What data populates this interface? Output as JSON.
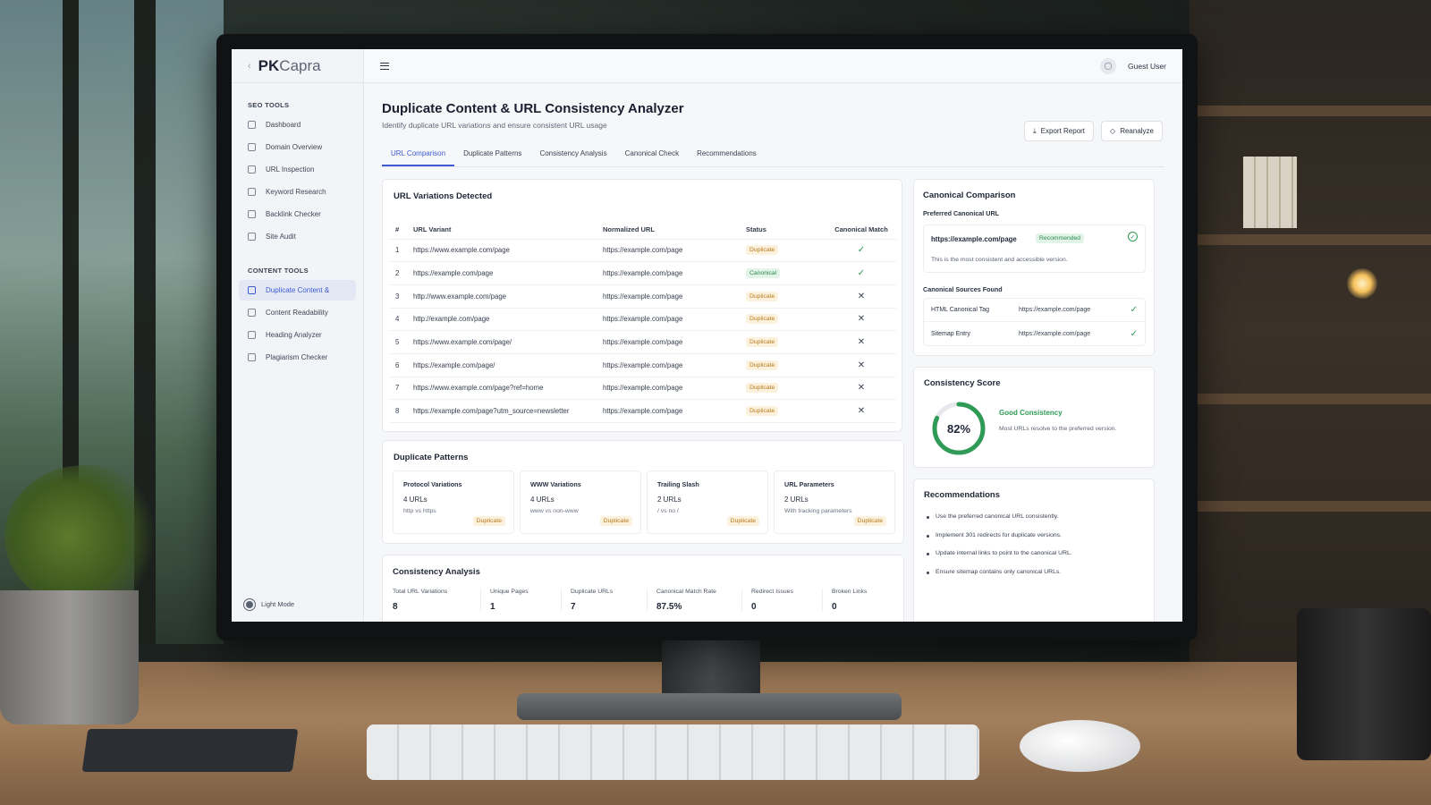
{
  "brand": {
    "pk": "PK",
    "capra": "Capra"
  },
  "sidebar": {
    "seo_title": "SEO TOOLS",
    "seo_items": [
      {
        "label": "Dashboard",
        "icon": "home-icon"
      },
      {
        "label": "Domain Overview",
        "icon": "grid-icon"
      },
      {
        "label": "URL Inspection",
        "icon": "search-icon"
      },
      {
        "label": "Keyword Research",
        "icon": "key-icon"
      },
      {
        "label": "Backlink Checker",
        "icon": "link-icon"
      },
      {
        "label": "Site Audit",
        "icon": "audit-icon"
      }
    ],
    "content_title": "CONTENT TOOLS",
    "content_items": [
      {
        "label": "Duplicate Content &",
        "icon": "duplicate-icon",
        "active": true
      },
      {
        "label": "Content Readability",
        "icon": "document-icon"
      },
      {
        "label": "Heading Analyzer",
        "icon": "heading-icon"
      },
      {
        "label": "Plagiarism Checker",
        "icon": "shield-icon"
      }
    ],
    "light_mode": "Light Mode"
  },
  "topbar": {
    "user": "Guest User"
  },
  "page": {
    "title": "Duplicate Content & URL Consistency Analyzer",
    "subtitle": "Identify duplicate URL variations and ensure consistent URL usage",
    "export": "Export Report",
    "reanalyze": "Reanalyze"
  },
  "tabs": [
    "URL Comparison",
    "Duplicate Patterns",
    "Consistency Analysis",
    "Canonical Check",
    "Recommendations"
  ],
  "url_table": {
    "title": "URL Variations Detected",
    "headers": [
      "#",
      "URL Variant",
      "Normalized URL",
      "Status",
      "Canonical Match"
    ],
    "rows": [
      {
        "n": "1",
        "variant": "https://www.example.com/page",
        "normalized": "https://example.com/page",
        "status": "Duplicate",
        "match": "✓"
      },
      {
        "n": "2",
        "variant": "https://example.com/page",
        "normalized": "https://example.com/page",
        "status": "Canonical",
        "match": "✓"
      },
      {
        "n": "3",
        "variant": "http://www.example.com/page",
        "normalized": "https://example.com/page",
        "status": "Duplicate",
        "match": "✕"
      },
      {
        "n": "4",
        "variant": "http://example.com/page",
        "normalized": "https://example.com/page",
        "status": "Duplicate",
        "match": "✕"
      },
      {
        "n": "5",
        "variant": "https://www.example.com/page/",
        "normalized": "https://example.com/page",
        "status": "Duplicate",
        "match": "✕"
      },
      {
        "n": "6",
        "variant": "https://example.com/page/",
        "normalized": "https://example.com/page",
        "status": "Duplicate",
        "match": "✕"
      },
      {
        "n": "7",
        "variant": "https://www.example.com/page?ref=home",
        "normalized": "https://example.com/page",
        "status": "Duplicate",
        "match": "✕"
      },
      {
        "n": "8",
        "variant": "https://example.com/page?utm_source=newsletter",
        "normalized": "https://example.com/page",
        "status": "Duplicate",
        "match": "✕"
      }
    ]
  },
  "patterns": {
    "title": "Duplicate Patterns",
    "items": [
      {
        "title": "Protocol Variations",
        "count": "4 URLs",
        "desc": "http vs https",
        "badge": "Duplicate"
      },
      {
        "title": "WWW Variations",
        "count": "4 URLs",
        "desc": "www vs non-www",
        "badge": "Duplicate"
      },
      {
        "title": "Trailing Slash",
        "count": "2 URLs",
        "desc": "/ vs no /",
        "badge": "Duplicate"
      },
      {
        "title": "URL Parameters",
        "count": "2 URLs",
        "desc": "With tracking parameters",
        "badge": "Duplicate"
      }
    ]
  },
  "analysis": {
    "title": "Consistency Analysis",
    "metrics": [
      {
        "label": "Total URL Variations",
        "value": "8"
      },
      {
        "label": "Unique Pages",
        "value": "1"
      },
      {
        "label": "Duplicate URLs",
        "value": "7"
      },
      {
        "label": "Canonical Match Rate",
        "value": "87.5%"
      },
      {
        "label": "Redirect Issues",
        "value": "0"
      },
      {
        "label": "Broken Links",
        "value": "0"
      }
    ]
  },
  "canonical": {
    "title": "Canonical Comparison",
    "preferred_label": "Preferred Canonical URL",
    "preferred_url": "https://example.com/page",
    "preferred_badge": "Recommended",
    "preferred_note": "This is the most consistent and accessible version.",
    "sources_label": "Canonical Sources Found",
    "sources": [
      {
        "name": "HTML Canonical Tag",
        "url": "https://example.com/page"
      },
      {
        "name": "Sitemap Entry",
        "url": "https://example.com/page"
      }
    ]
  },
  "score": {
    "title": "Consistency Score",
    "value": 82,
    "label": "82%",
    "status": "Good Consistency",
    "note": "Most URLs resolve to the preferred version.",
    "color": "#2e9a55"
  },
  "recommendations": {
    "title": "Recommendations",
    "items": [
      "Use the preferred canonical URL consistently.",
      "Implement 301 redirects for duplicate versions.",
      "Update internal links to point to the canonical URL.",
      "Ensure sitemap contains only canonical URLs."
    ]
  }
}
